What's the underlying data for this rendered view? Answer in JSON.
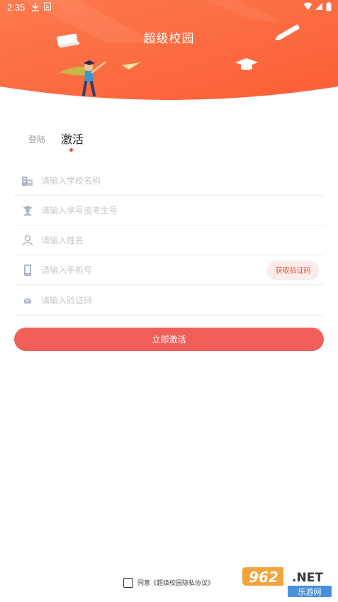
{
  "status_bar": {
    "time": "2:35",
    "left_icons": [
      "download-icon",
      "a-badge-icon"
    ],
    "right_icons": [
      "wifi-icon",
      "signal-icon",
      "battery-icon"
    ]
  },
  "header": {
    "title": "超级校园",
    "background_color": "#fc6a3e"
  },
  "tabs": {
    "login": "登陆",
    "activate": "激活",
    "active_tab": "activate"
  },
  "form": {
    "school": {
      "placeholder": "请输入学校名称",
      "value": "",
      "icon": "building-icon"
    },
    "student_id": {
      "placeholder": "请输入学号或考生号",
      "value": "",
      "icon": "graduate-icon"
    },
    "name": {
      "placeholder": "请输入姓名",
      "value": "",
      "icon": "person-icon"
    },
    "phone": {
      "placeholder": "请输入手机号",
      "value": "",
      "icon": "phone-icon"
    },
    "code": {
      "placeholder": "请输入验证码",
      "value": "",
      "icon": "mail-icon"
    },
    "get_code_label": "获取验证码"
  },
  "submit_label": "立即激活",
  "agreement": {
    "text": "同意《超级校园隐私协议》",
    "checked": false
  },
  "watermark": {
    "number": "962",
    "suffix": ".NET",
    "subtitle": "乐游网"
  },
  "colors": {
    "accent": "#f05f5a",
    "header": "#fc6a3e",
    "code_button_text": "#e0573f"
  }
}
